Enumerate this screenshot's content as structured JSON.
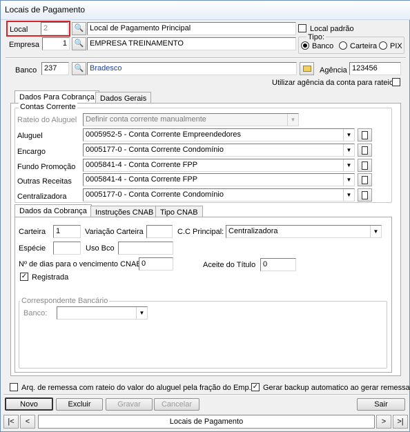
{
  "window": {
    "title": "Locais de Pagamento"
  },
  "local": {
    "label": "Local",
    "value": "2",
    "description": "Local de Pagamento Principal",
    "padrao_label": "Local padrão"
  },
  "empresa": {
    "label": "Empresa",
    "value": "1",
    "description": "EMPRESA TREINAMENTO"
  },
  "tipo": {
    "label": "Tipo:",
    "options": [
      "Banco",
      "Carteira",
      "PIX"
    ],
    "selected": "Banco"
  },
  "banco": {
    "label": "Banco",
    "code": "237",
    "name": "Bradesco",
    "agencia_label": "Agência",
    "agencia_value": "123456",
    "utilizar_agencia_label": "Utilizar agência da conta para rateio"
  },
  "tabs": [
    "Dados Para Cobrança",
    "Dados Gerais"
  ],
  "contas": {
    "group_label": "Contas Corrente",
    "rateio_label": "Rateio do Aluguel",
    "rateio_value": "Definir conta corrente manualmente",
    "rows": [
      {
        "label": "Aluguel",
        "value": "0005952-5 - Conta Corrente Empreendedores"
      },
      {
        "label": "Encargo",
        "value": "0005177-0 - Conta Corrente Condomínio"
      },
      {
        "label": "Fundo Promoção",
        "value": "0005841-4 - Conta Corrente FPP"
      },
      {
        "label": "Outras Receitas",
        "value": "0005841-4 - Conta Corrente FPP"
      },
      {
        "label": "Centralizadora",
        "value": "0005177-0 - Conta Corrente Condomínio"
      }
    ]
  },
  "subtabs": [
    "Dados da Cobrança",
    "Instruções CNAB",
    "Tipo CNAB"
  ],
  "cobranca": {
    "carteira_label": "Carteira",
    "carteira_value": "1",
    "variacao_label": "Variação Carteira",
    "variacao_value": "",
    "cc_principal_label": "C.C Principal:",
    "cc_principal_value": "Centralizadora",
    "especie_label": "Espécie",
    "especie_value": "",
    "uso_bco_label": "Uso Bco",
    "uso_bco_value": "",
    "dias_label": "Nº de dias para o vencimento CNAB",
    "dias_value": "0",
    "aceite_label": "Aceite do Título",
    "aceite_value": "0",
    "registrada_label": "Registrada"
  },
  "correspondente": {
    "group_label": "Correspondente Bancário",
    "banco_label": "Banco:",
    "banco_value": ""
  },
  "options": {
    "arq_remessa_label": "Arq. de remessa com rateio do valor do aluguel pela fração do Emp.",
    "backup_label": "Gerar backup automatico ao gerar remessa"
  },
  "buttons": {
    "novo": "Novo",
    "excluir": "Excluir",
    "gravar": "Gravar",
    "cancelar": "Cancelar",
    "sair": "Sair"
  },
  "nav": {
    "first": "|<",
    "prev": "<",
    "caption": "Locais de Pagamento",
    "next": ">",
    "last": ">|"
  }
}
